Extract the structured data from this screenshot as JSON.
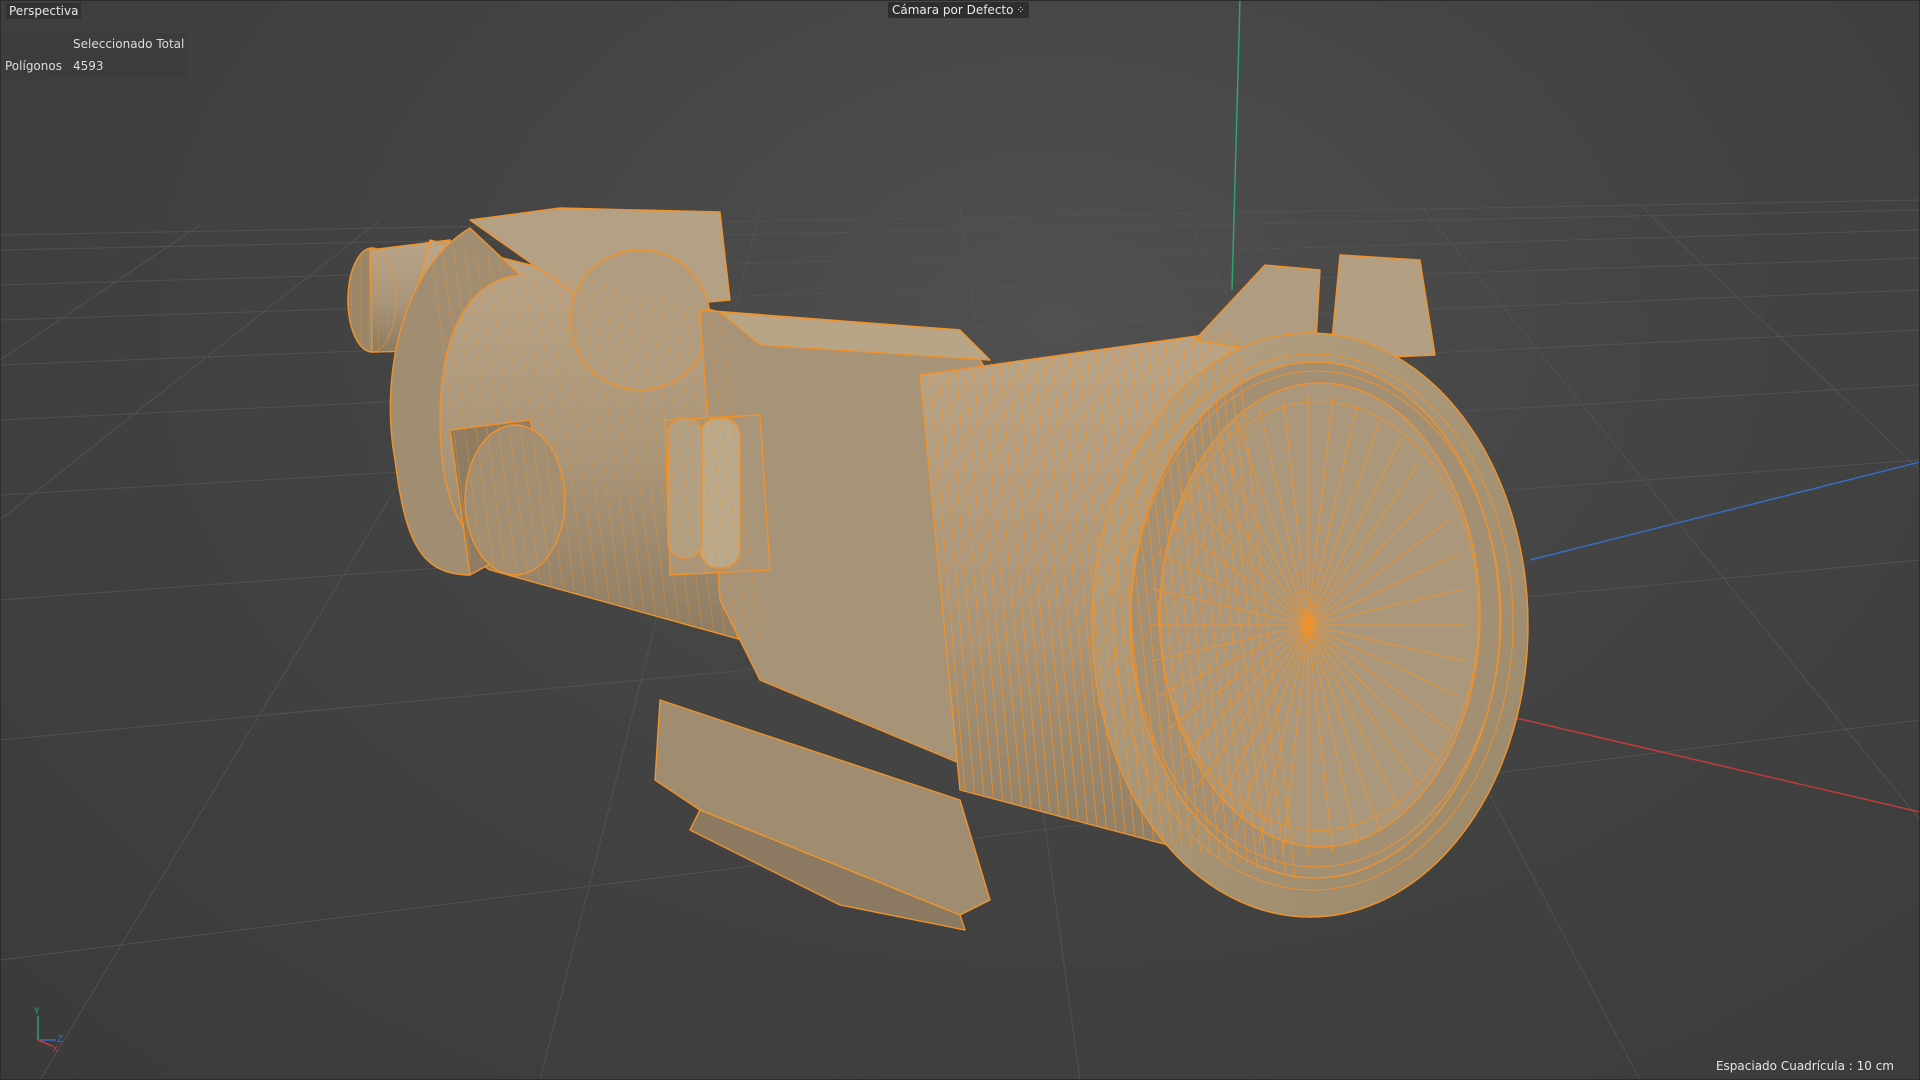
{
  "viewport": {
    "view_name": "Perspectiva",
    "camera_label": "Cámara por Defecto",
    "camera_icon": "camera-options-icon"
  },
  "hud": {
    "header": "Seleccionado Total",
    "polygons_label": "Polígonos",
    "polygons_value": "4593"
  },
  "footer": {
    "grid_spacing": "Espaciado Cuadrícula : 10 cm"
  },
  "gizmo": {
    "y": "Y",
    "z": "Z",
    "x": "X"
  },
  "colors": {
    "background": "#3c3c3c",
    "model_fill": "#a8957a",
    "wire": "#f0922a",
    "axis_x": "#c23b3b",
    "axis_y": "#2fa36a",
    "axis_z": "#3a6bc4"
  }
}
